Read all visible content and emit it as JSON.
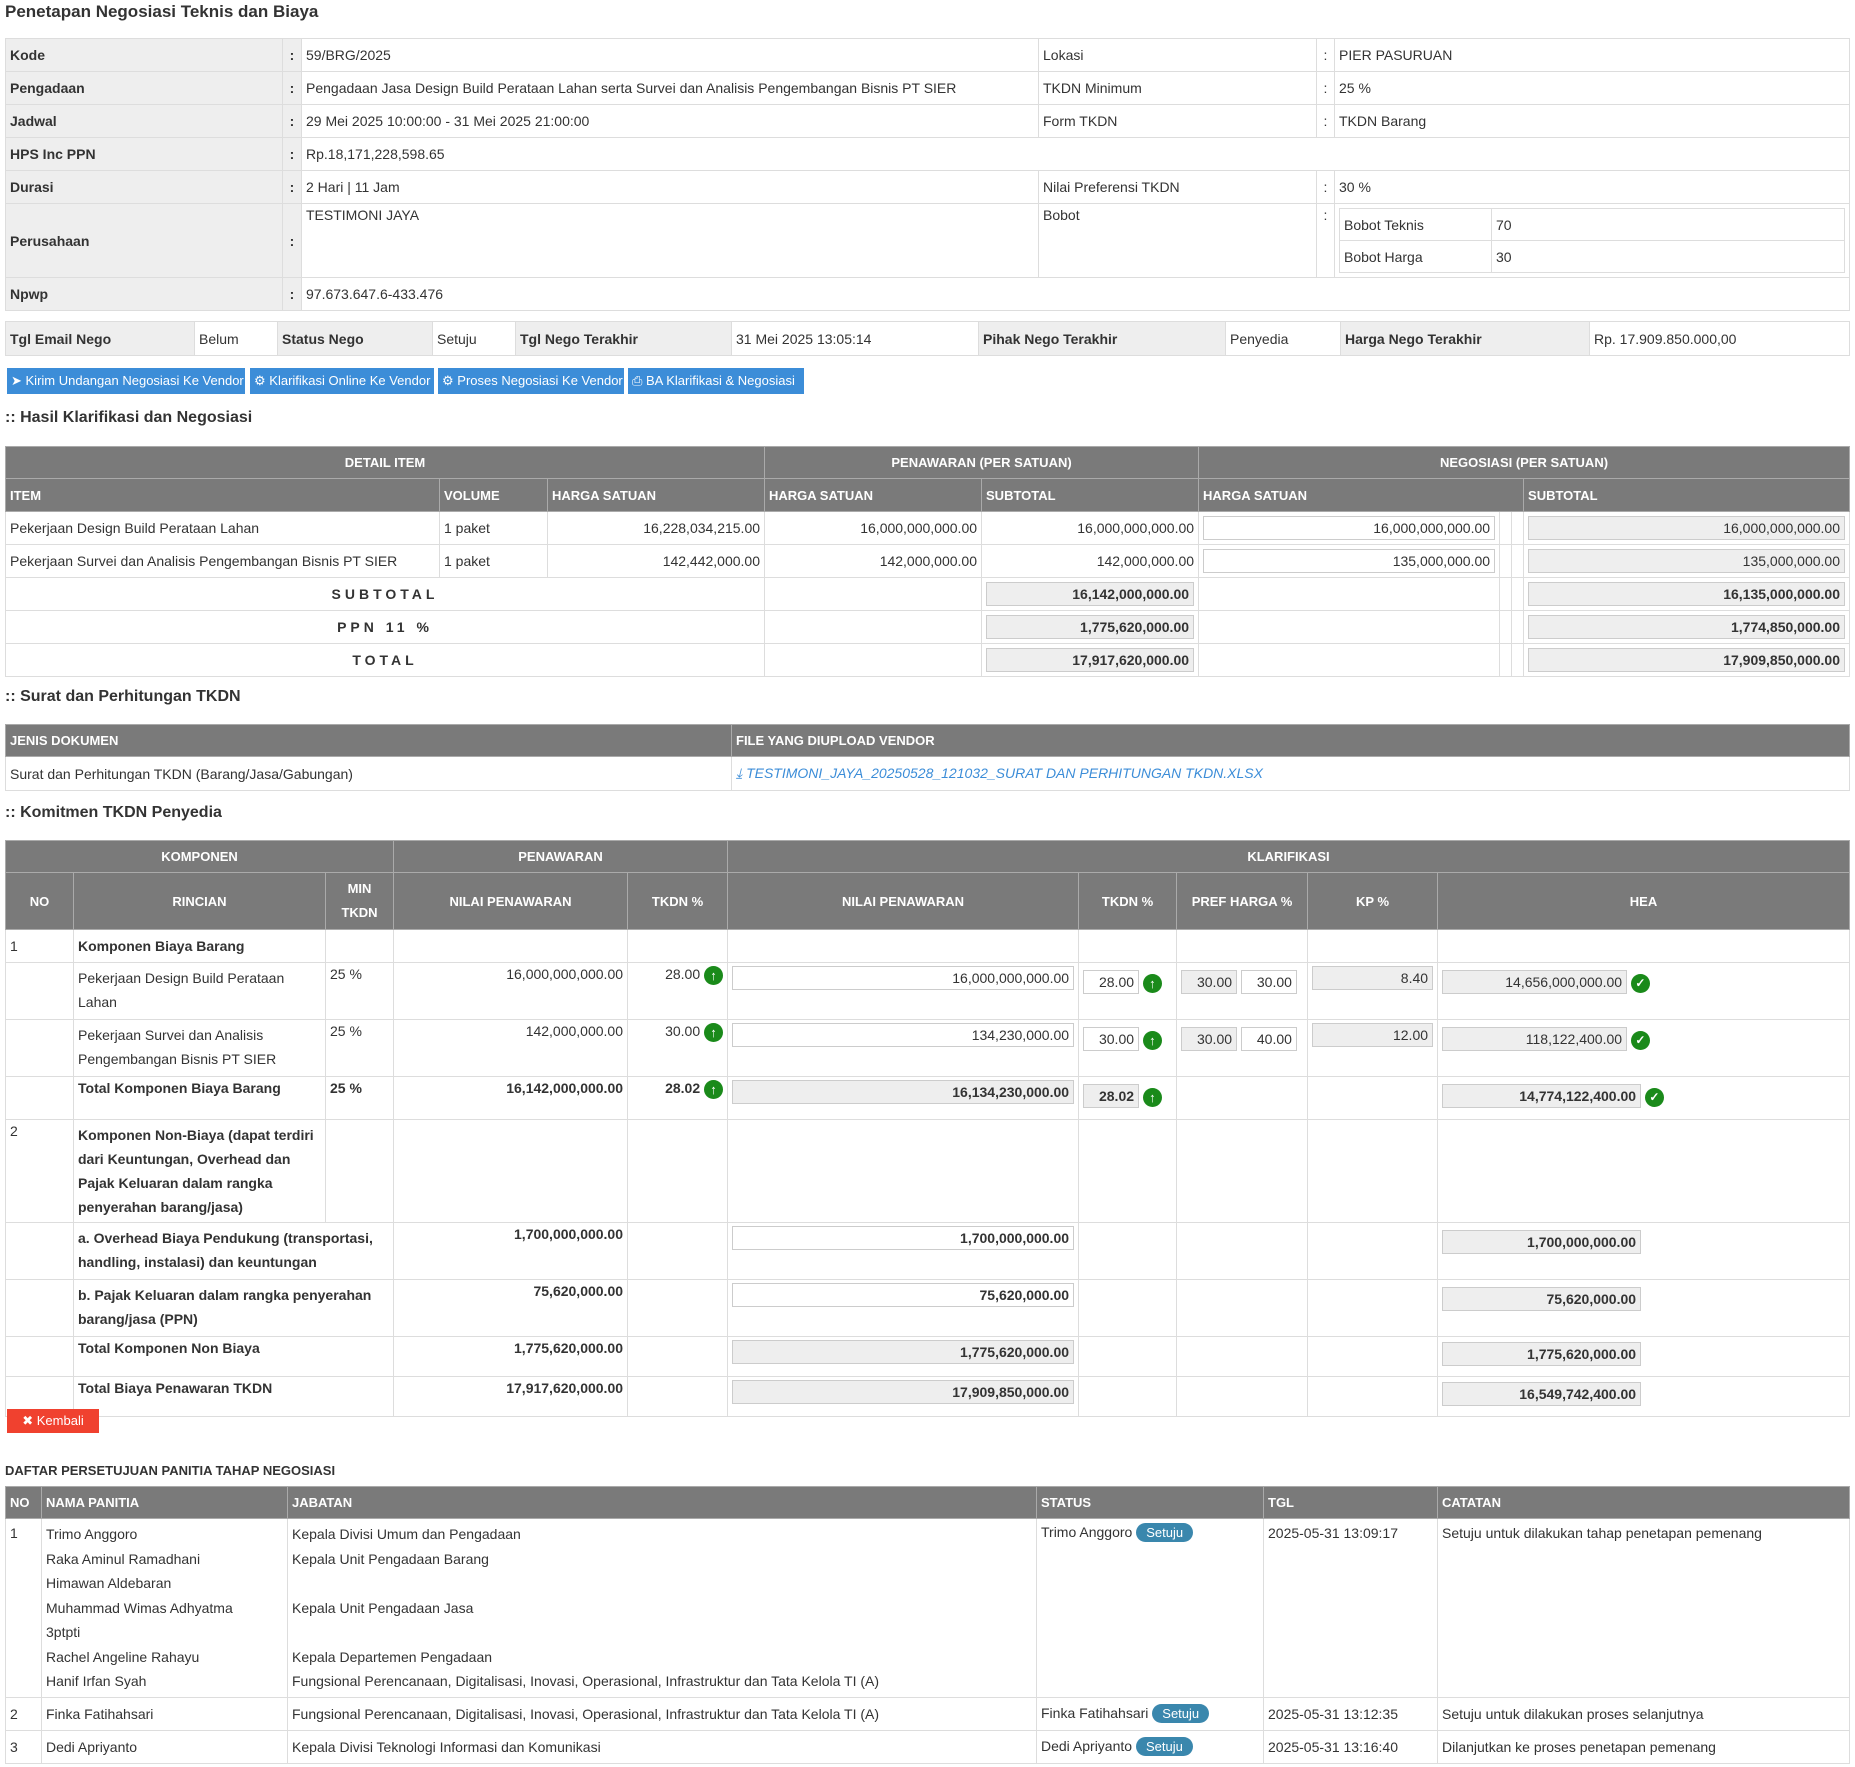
{
  "title": "Penetapan Negosiasi Teknis dan Biaya",
  "info": {
    "kode_label": "Kode",
    "kode": "59/BRG/2025",
    "pengadaan_label": "Pengadaan",
    "pengadaan": "Pengadaan Jasa Design Build Perataan Lahan serta Survei dan Analisis Pengembangan Bisnis PT SIER",
    "jadwal_label": "Jadwal",
    "jadwal": "29 Mei 2025 10:00:00 - 31 Mei 2025 21:00:00",
    "hps_label": "HPS Inc PPN",
    "hps": "Rp.18,171,228,598.65",
    "durasi_label": "Durasi",
    "durasi": "2 Hari | 11 Jam",
    "perusahaan_label": "Perusahaan",
    "perusahaan": "TESTIMONI JAYA",
    "npwp_label": "Npwp",
    "npwp": "97.673.647.6-433.476",
    "lokasi_label": "Lokasi",
    "lokasi": "PIER PASURUAN",
    "tkdn_min_label": "TKDN Minimum",
    "tkdn_min": "25 %",
    "form_tkdn_label": "Form TKDN",
    "form_tkdn": "TKDN Barang",
    "pref_label": "Nilai Preferensi TKDN",
    "pref": "30 %",
    "bobot_label": "Bobot",
    "bobot_teknis_label": "Bobot Teknis",
    "bobot_teknis": "70",
    "bobot_harga_label": "Bobot Harga",
    "bobot_harga": "30",
    "colon": ":"
  },
  "nego_status": {
    "tgl_email_label": "Tgl Email Nego",
    "tgl_email": "Belum",
    "status_label": "Status Nego",
    "status": "Setuju",
    "tgl_terakhir_label": "Tgl Nego Terakhir",
    "tgl_terakhir": "31 Mei 2025 13:05:14",
    "pihak_label": "Pihak Nego Terakhir",
    "pihak": "Penyedia",
    "harga_label": "Harga Nego Terakhir",
    "harga": "Rp. 17.909.850.000,00"
  },
  "buttons": {
    "kirim": "Kirim Undangan Negosiasi Ke Vendor",
    "klarifikasi": "Klarifikasi Online Ke Vendor",
    "proses": "Proses Negosiasi Ke Vendor",
    "ba": "BA Klarifikasi & Negosiasi",
    "kembali": "Kembali"
  },
  "hasil": {
    "title": ":: Hasil Klarifikasi dan Negosiasi",
    "h_detail": "DETAIL ITEM",
    "h_penawaran": "PENAWARAN (PER SATUAN)",
    "h_negosiasi": "NEGOSIASI (PER SATUAN)",
    "h_item": "ITEM",
    "h_volume": "VOLUME",
    "h_harga": "HARGA SATUAN",
    "h_subtotal": "SUBTOTAL",
    "rows": [
      {
        "item": "Pekerjaan Design Build Perataan Lahan",
        "volume": "1 paket",
        "harga": "16,228,034,215.00",
        "pen_harga": "16,000,000,000.00",
        "pen_subtotal": "16,000,000,000.00",
        "neg_harga": "16,000,000,000.00",
        "neg_subtotal": "16,000,000,000.00"
      },
      {
        "item": "Pekerjaan Survei dan Analisis Pengembangan Bisnis PT SIER",
        "volume": "1 paket",
        "harga": "142,442,000.00",
        "pen_harga": "142,000,000.00",
        "pen_subtotal": "142,000,000.00",
        "neg_harga": "135,000,000.00",
        "neg_subtotal": "135,000,000.00"
      }
    ],
    "subtotal_label": "SUBTOTAL",
    "ppn_label": "PPN 11 %",
    "total_label": "TOTAL",
    "pen_subtotal": "16,142,000,000.00",
    "pen_ppn": "1,775,620,000.00",
    "pen_total": "17,917,620,000.00",
    "neg_subtotal": "16,135,000,000.00",
    "neg_ppn": "1,774,850,000.00",
    "neg_total": "17,909,850,000.00"
  },
  "surat": {
    "title": ":: Surat dan Perhitungan TKDN",
    "h_jenis": "JENIS DOKUMEN",
    "h_file": "FILE YANG DIUPLOAD VENDOR",
    "jenis": "Surat dan Perhitungan TKDN (Barang/Jasa/Gabungan)",
    "file": "TESTIMONI_JAYA_20250528_121032_SURAT DAN PERHITUNGAN TKDN.XLSX"
  },
  "komitmen": {
    "title": ":: Komitmen TKDN Penyedia",
    "h_komponen": "KOMPONEN",
    "h_penawaran": "PENAWARAN",
    "h_klarifikasi": "KLARIFIKASI",
    "h_no": "NO",
    "h_rincian": "RINCIAN",
    "h_min1": "MIN",
    "h_min2": "TKDN",
    "h_nilai": "NILAI PENAWARAN",
    "h_tkdn": "TKDN %",
    "h_pref": "PREF HARGA %",
    "h_kp": "KP %",
    "h_hea": "HEA",
    "g1_no": "1",
    "g1_title": "Komponen Biaya Barang",
    "items": [
      {
        "rincian": "Pekerjaan Design Build Perataan Lahan",
        "min": "25 %",
        "nilai": "16,000,000,000.00",
        "tkdn": "28.00",
        "k_nilai": "16,000,000,000.00",
        "k_tkdn": "28.00",
        "pref1": "30.00",
        "pref2": "30.00",
        "kp": "8.40",
        "hea": "14,656,000,000.00"
      },
      {
        "rincian": "Pekerjaan Survei dan Analisis Pengembangan Bisnis PT SIER",
        "min": "25 %",
        "nilai": "142,000,000.00",
        "tkdn": "30.00",
        "k_nilai": "134,230,000.00",
        "k_tkdn": "30.00",
        "pref1": "30.00",
        "pref2": "40.00",
        "kp": "12.00",
        "hea": "118,122,400.00"
      }
    ],
    "total_barang": {
      "label": "Total Komponen Biaya Barang",
      "min": "25 %",
      "nilai": "16,142,000,000.00",
      "tkdn": "28.02",
      "k_nilai": "16,134,230,000.00",
      "k_tkdn": "28.02",
      "hea": "14,774,122,400.00"
    },
    "g2_no": "2",
    "g2_title": "Komponen Non-Biaya (dapat terdiri dari Keuntungan, Overhead dan Pajak Keluaran dalam rangka penyerahan barang/jasa)",
    "overhead": {
      "label": "a. Overhead Biaya Pendukung (transportasi, handling, instalasi) dan keuntungan",
      "nilai": "1,700,000,000.00",
      "k_nilai": "1,700,000,000.00",
      "hea": "1,700,000,000.00"
    },
    "pajak": {
      "label": "b. Pajak Keluaran dalam rangka penyerahan barang/jasa (PPN)",
      "nilai": "75,620,000.00",
      "k_nilai": "75,620,000.00",
      "hea": "75,620,000.00"
    },
    "total_non": {
      "label": "Total Komponen Non Biaya",
      "nilai": "1,775,620,000.00",
      "k_nilai": "1,775,620,000.00",
      "hea": "1,775,620,000.00"
    },
    "total_biaya": {
      "label": "Total Biaya Penawaran TKDN",
      "nilai": "17,917,620,000.00",
      "k_nilai": "17,909,850,000.00",
      "hea": "16,549,742,400.00"
    }
  },
  "daftar": {
    "title": "DAFTAR PERSETUJUAN PANITIA TAHAP NEGOSIASI",
    "h_no": "NO",
    "h_nama": "NAMA PANITIA",
    "h_jabatan": "JABATAN",
    "h_status": "STATUS",
    "h_tgl": "TGL",
    "h_catatan": "CATATAN",
    "rows": [
      {
        "no": "1",
        "nama": [
          "Trimo Anggoro",
          "Raka Aminul Ramadhani",
          "Himawan Aldebaran",
          "Muhammad Wimas Adhyatma",
          "3ptpti",
          "Rachel Angeline Rahayu",
          "Hanif Irfan Syah"
        ],
        "jabatan": [
          "Kepala Divisi Umum dan Pengadaan",
          "Kepala Unit Pengadaan Barang",
          "",
          "Kepala Unit Pengadaan Jasa",
          "",
          "Kepala Departemen Pengadaan",
          "Fungsional Perencanaan, Digitalisasi, Inovasi, Operasional, Infrastruktur dan Tata Kelola TI (A)"
        ],
        "status_name": "Trimo Anggoro",
        "status": "Setuju",
        "tgl": "2025-05-31 13:09:17",
        "catatan": "Setuju untuk dilakukan tahap penetapan pemenang"
      },
      {
        "no": "2",
        "nama": [
          "Finka Fatihahsari"
        ],
        "jabatan": [
          "Fungsional Perencanaan, Digitalisasi, Inovasi, Operasional, Infrastruktur dan Tata Kelola TI (A)"
        ],
        "status_name": "Finka Fatihahsari",
        "status": "Setuju",
        "tgl": "2025-05-31 13:12:35",
        "catatan": "Setuju untuk dilakukan proses selanjutnya"
      },
      {
        "no": "3",
        "nama": [
          "Dedi Apriyanto"
        ],
        "jabatan": [
          "Kepala Divisi Teknologi Informasi dan Komunikasi"
        ],
        "status_name": "Dedi Apriyanto",
        "status": "Setuju",
        "tgl": "2025-05-31 13:16:40",
        "catatan": "Dilanjutkan ke proses penetapan pemenang"
      }
    ]
  },
  "colors": {
    "header": "#7a7a7a",
    "button": "#3c8dd8",
    "danger": "#f0412f",
    "success": "#1a8a1a",
    "badge": "#3a87ad"
  }
}
